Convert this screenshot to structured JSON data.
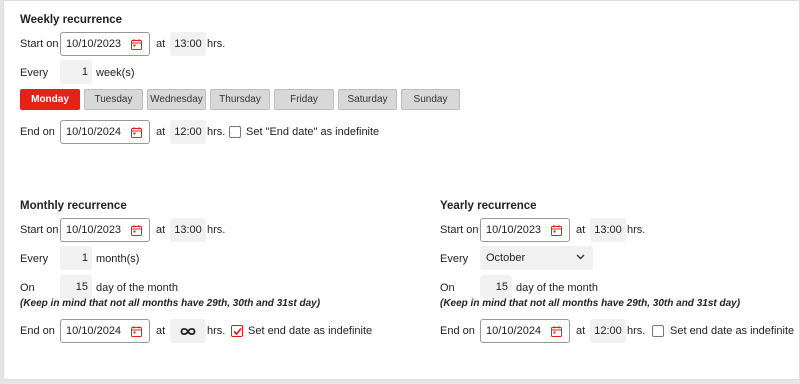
{
  "weekly": {
    "title": "Weekly recurrence",
    "start_label": "Start on",
    "start_date": "10/10/2023",
    "at_label": "at",
    "start_time": "13:00",
    "hrs_label": "hrs.",
    "every_label": "Every",
    "every_value": "1",
    "every_unit": "week(s)",
    "days": [
      {
        "label": "Monday",
        "active": true
      },
      {
        "label": "Tuesday",
        "active": false
      },
      {
        "label": "Wednesday",
        "active": false
      },
      {
        "label": "Thursday",
        "active": false
      },
      {
        "label": "Friday",
        "active": false
      },
      {
        "label": "Saturday",
        "active": false
      },
      {
        "label": "Sunday",
        "active": false
      }
    ],
    "end_label": "End on",
    "end_date": "10/10/2024",
    "end_time": "12:00",
    "indefinite_label": "Set \"End date\" as indefinite",
    "indefinite_checked": false
  },
  "monthly": {
    "title": "Monthly recurrence",
    "start_label": "Start on",
    "start_date": "10/10/2023",
    "at_label": "at",
    "start_time": "13:00",
    "hrs_label": "hrs.",
    "every_label": "Every",
    "every_value": "1",
    "every_unit": "month(s)",
    "on_label": "On",
    "on_value": "15",
    "on_unit": "day of the month",
    "note": "(Keep in mind that not all months have 29th, 30th and 31st day)",
    "end_label": "End on",
    "end_date": "10/10/2024",
    "end_time_icon": "infinity-icon",
    "indefinite_label": "Set end date as indefinite",
    "indefinite_checked": true
  },
  "yearly": {
    "title": "Yearly recurrence",
    "start_label": "Start on",
    "start_date": "10/10/2023",
    "at_label": "at",
    "start_time": "13:00",
    "hrs_label": "hrs.",
    "every_label": "Every",
    "every_month": "October",
    "on_label": "On",
    "on_value": "15",
    "on_unit": "day of the month",
    "note": "(Keep in mind that not all months have 29th, 30th and 31st day)",
    "end_label": "End on",
    "end_date": "10/10/2024",
    "end_time": "12:00",
    "indefinite_label": "Set end date as indefinite",
    "indefinite_checked": false
  },
  "colors": {
    "accent": "#e3231a",
    "day_button_bg": "#d8d8d8",
    "time_box_bg": "#f1f1f1"
  },
  "icons": {
    "calendar": "calendar-icon",
    "check": "checkmark-icon",
    "chevron": "chevron-down-icon"
  }
}
